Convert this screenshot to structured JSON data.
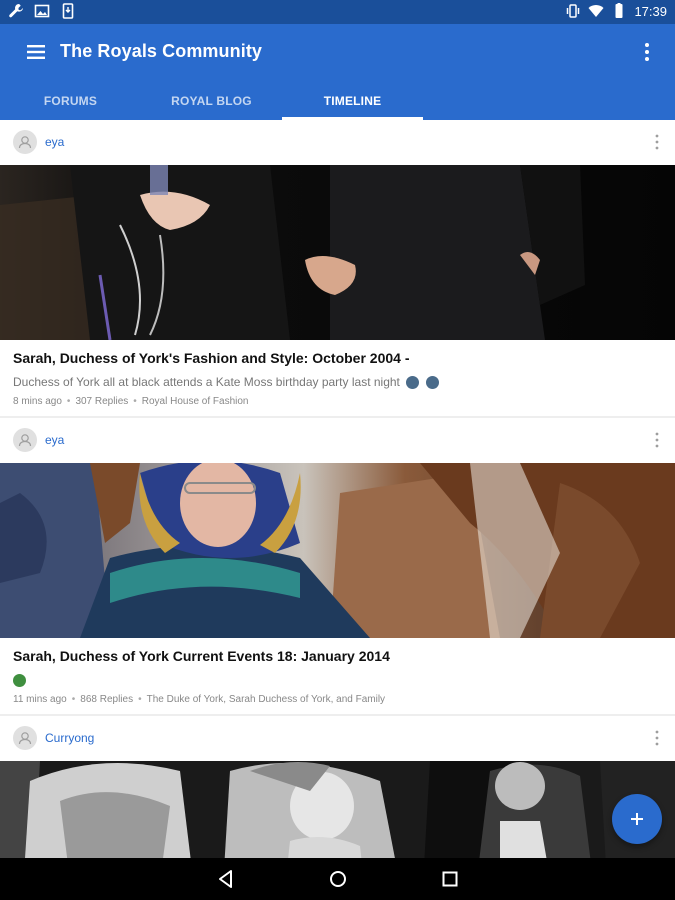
{
  "status_bar": {
    "time": "17:39",
    "left_icons": [
      "wrench-icon",
      "image-icon",
      "phone-download-icon"
    ],
    "right_icons": [
      "vibrate-icon",
      "wifi-icon",
      "battery-icon"
    ]
  },
  "app_bar": {
    "title": "The Royals Community",
    "color": "#2a6bcd",
    "status_color": "#1a4f9a"
  },
  "tabs": [
    {
      "label": "FORUMS",
      "active": false
    },
    {
      "label": "ROYAL BLOG",
      "active": false
    },
    {
      "label": "TIMELINE",
      "active": true
    }
  ],
  "posts": [
    {
      "user": "eya",
      "title": "Sarah, Duchess of York's Fashion and Style: October 2004 -",
      "excerpt": "Duchess of York all at black attends a Kate Moss birthday party last night",
      "time": "8 mins ago",
      "replies": "307 Replies",
      "forum": "Royal House of Fashion",
      "image": "photo-couple-holding-hands"
    },
    {
      "user": "eya",
      "title": "Sarah, Duchess of York Current Events 18: January 2014",
      "excerpt": "",
      "time": "11 mins ago",
      "replies": "868 Replies",
      "forum": "The Duke of York, Sarah Duchess of York, and Family",
      "image": "photo-woman-headscarf-horses"
    },
    {
      "user": "Curryong",
      "title": "",
      "excerpt": "",
      "time": "",
      "replies": "",
      "forum": "",
      "image": "photo-black-and-white-family"
    }
  ],
  "fab_icon": "plus-icon",
  "nav_icons": [
    "back-icon",
    "home-icon",
    "recents-icon"
  ]
}
